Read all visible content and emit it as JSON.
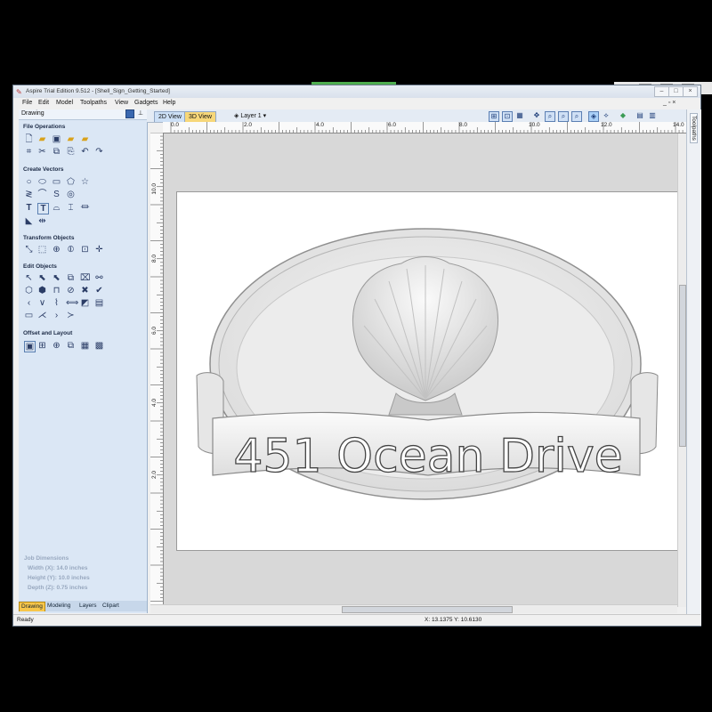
{
  "window": {
    "title": "Aspire Trial Edition 9.512 - [Shell_Sign_Getting_Started]",
    "minimize_icon": "minimize-icon",
    "maximize_icon": "maximize-icon",
    "close_icon": "close-icon"
  },
  "menu": {
    "items": [
      "File",
      "Edit",
      "Model",
      "Toolpaths",
      "View",
      "Gadgets",
      "Help"
    ],
    "mdi_controls": "_ ▫ ×"
  },
  "left_panel": {
    "title": "Drawing",
    "sections": [
      {
        "title": "File Operations"
      },
      {
        "title": "Create Vectors"
      },
      {
        "title": "Transform Objects"
      },
      {
        "title": "Edit Objects"
      },
      {
        "title": "Offset and Layout"
      }
    ],
    "job_dimensions": {
      "heading": "Job Dimensions",
      "width": "Width  (X): 14.0 inches",
      "height": "Height (Y): 10.0 inches",
      "depth": "Depth  (Z): 0.75 inches"
    },
    "bottom_tabs": [
      "Drawing",
      "Modeling",
      "Layers",
      "Clipart"
    ],
    "active_bottom_tab": "Drawing"
  },
  "view_tabs": {
    "tab_2d": "2D View",
    "tab_3d": "3D View",
    "layer": "Layer 1",
    "layer_dropdown_icon": "chevron-down-icon"
  },
  "right_tab": {
    "label": "Toolpaths"
  },
  "rulers": {
    "horizontal": [
      "0.0",
      "2.0",
      "4.0",
      "6.0",
      "8.0",
      "10.0",
      "12.0",
      "14.0"
    ],
    "vertical": [
      "10.0",
      "8.0",
      "6.0",
      "4.0",
      "2.0"
    ]
  },
  "sign": {
    "text": "451 Ocean Drive",
    "shape": "oval-plaque-with-shell-and-banner"
  },
  "status": {
    "ready": "Ready",
    "coords": "X: 13.1375 Y: 10.6130"
  }
}
